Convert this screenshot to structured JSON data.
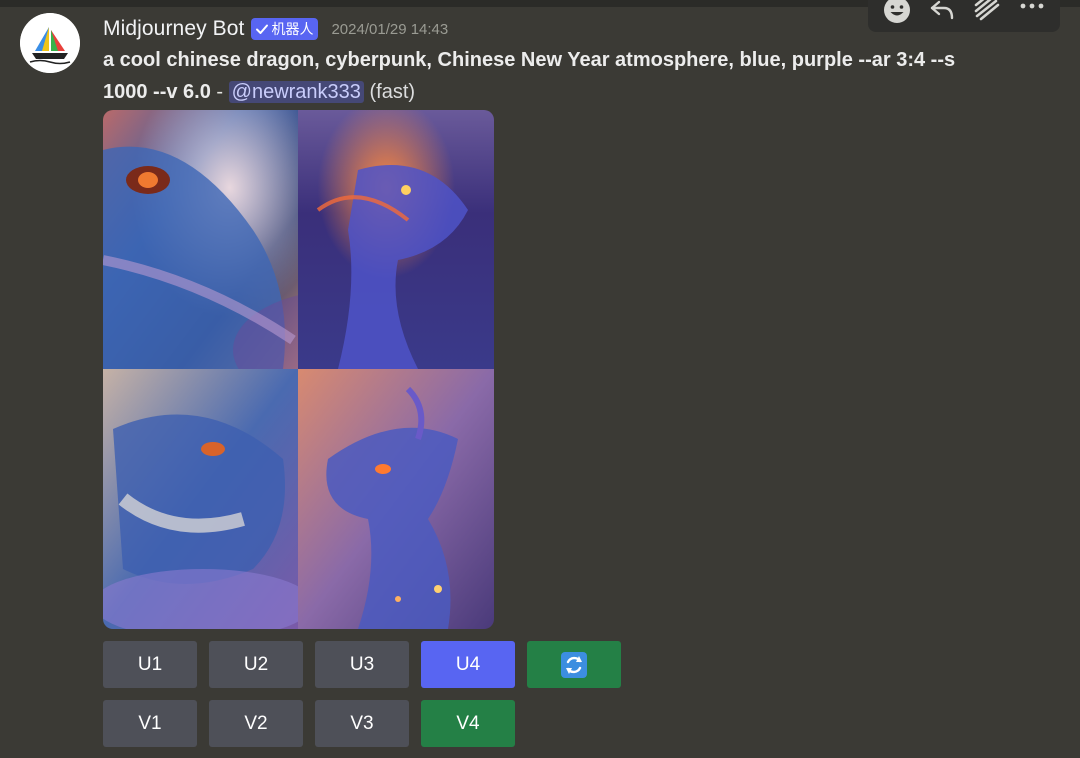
{
  "message": {
    "author": "Midjourney Bot",
    "bot_tag": "机器人",
    "timestamp": "2024/01/29 14:43",
    "prompt_text": "a cool chinese dragon, cyberpunk, Chinese New Year atmosphere, blue, purple --ar 3:4 --s 1000 --v 6.0",
    "separator": " - ",
    "mention": "@newrank333",
    "speed": "(fast)"
  },
  "image_grid": {
    "tiles": [
      "dragon-1",
      "dragon-2",
      "dragon-3",
      "dragon-4"
    ]
  },
  "buttons": {
    "row1": [
      {
        "label": "U1",
        "state": "default"
      },
      {
        "label": "U2",
        "state": "default"
      },
      {
        "label": "U3",
        "state": "default"
      },
      {
        "label": "U4",
        "state": "active"
      },
      {
        "icon": "refresh-icon",
        "state": "green"
      }
    ],
    "row2": [
      {
        "label": "V1",
        "state": "default"
      },
      {
        "label": "V2",
        "state": "default"
      },
      {
        "label": "V3",
        "state": "default"
      },
      {
        "label": "V4",
        "state": "green"
      }
    ]
  },
  "toolbar": {
    "icons": [
      "emoji-icon",
      "reply-icon",
      "thread-icon",
      "more-icon"
    ]
  },
  "colors": {
    "background": "#3b3a35",
    "blurple": "#5865f2",
    "green": "#248046",
    "button_gray": "#4e5058"
  }
}
